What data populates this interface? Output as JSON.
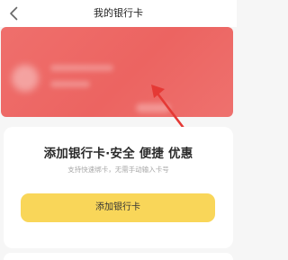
{
  "header": {
    "title": "我的银行卡",
    "back_icon": "chevron-left-icon"
  },
  "card": {
    "color": "#ec6461",
    "state": "blurred"
  },
  "annotation": {
    "arrow_color": "#e53935"
  },
  "promo": {
    "headline": "添加银行卡·安全 便捷 优惠",
    "subtext": "支持快速绑卡，无需手动输入卡号",
    "button_label": "添加银行卡",
    "button_color": "#f9d659"
  }
}
